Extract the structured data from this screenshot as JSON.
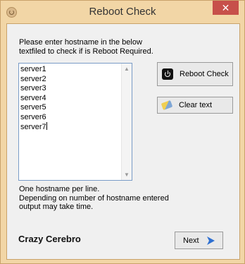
{
  "window": {
    "title": "Reboot Check",
    "close_glyph": "✕"
  },
  "instructions": "Please enter hostname in the below textfiled to check if is Reboot Required.",
  "textarea": {
    "lines": [
      "server1",
      "server2",
      "server3",
      "server4",
      "server5",
      "server6",
      "server7"
    ]
  },
  "hint": {
    "line1": "One hostname per line.",
    "line2": "Depending on number of hostname entered output may take time."
  },
  "buttons": {
    "reboot_check": "Reboot Check",
    "clear_text": "Clear text",
    "next": "Next"
  },
  "icons": {
    "app": "app-icon",
    "power": "power-icon",
    "eraser": "eraser-icon",
    "next": "arrow-right-icon"
  },
  "brand": "Crazy Cerebro",
  "colors": {
    "title_bar": "#f2d6a6",
    "close_button": "#c7504a",
    "next_arrow": "#2d6fd1"
  }
}
